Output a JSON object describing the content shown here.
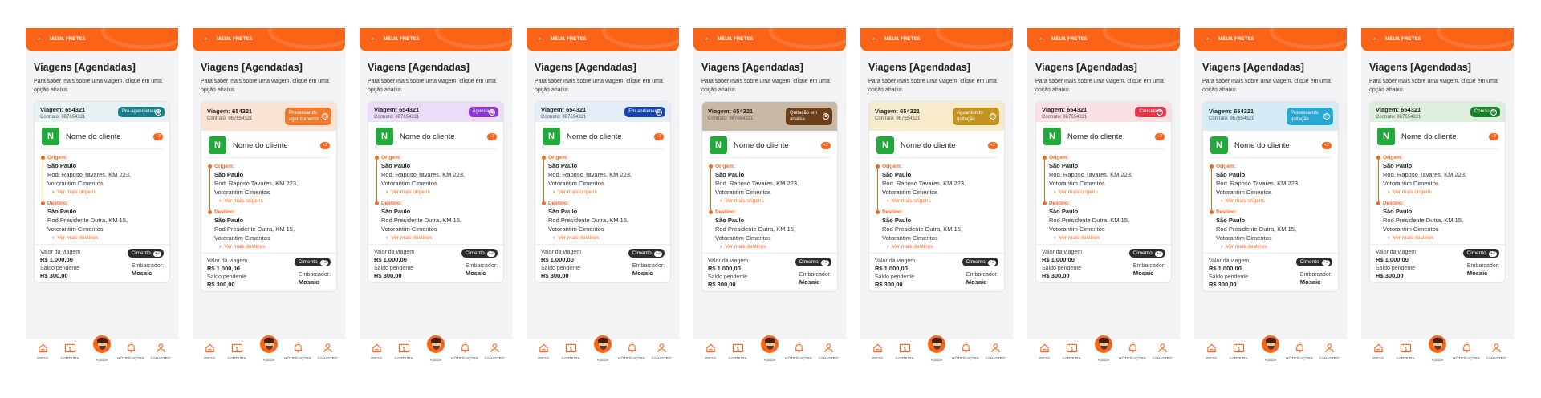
{
  "header_title": "MEUS FRETES",
  "page_title": "Viagens [Agendadas]",
  "page_subtitle": "Para saber mais sobre uma viagem, clique em uma opção abaixo.",
  "trip_label": "Viagem:",
  "trip_number": "654321",
  "contract_text": "Contrato: 987654321",
  "client_initial": "N",
  "client_name": "Nome do cliente",
  "client_more": "+2",
  "origin_label": "Origem:",
  "origin_city": "São Paulo",
  "origin_address_1": "Rod. Raposo Tavares, KM 223,",
  "origin_address_2": "Votorantim Cimentos",
  "more_origins": "Ver mais origens",
  "destination_label": "Destino:",
  "destination_city": "São Paulo",
  "destination_address_1": "Rod Presidente Dutra, KM 15,",
  "destination_address_2": "Votorantim Cimentos",
  "more_destinations": "Ver mais destinos",
  "value_label": "Valor da viagem",
  "value_amount": "R$ 1.000,00",
  "pending_label": "Saldo pendente",
  "pending_amount": "R$ 300,00",
  "cargo_label": "Cimento",
  "cargo_more": "+2",
  "shipper_label": "Embarcador:",
  "shipper_value": "Mosaic",
  "tabs": [
    {
      "label": "INICIO",
      "icon": "home-icon"
    },
    {
      "label": "CARTEIRA",
      "icon": "wallet-icon"
    },
    {
      "label": "AJUDA",
      "icon": "help-avatar"
    },
    {
      "label": "NOTIFICAÇÕES",
      "icon": "bell-icon"
    },
    {
      "label": "CADASTRO",
      "icon": "user-icon"
    }
  ],
  "colors": {
    "brand": "#fb6418",
    "client_logo": "#23a83c",
    "dark_chip": "#2c2c2e"
  },
  "screens": [
    {
      "status": "Pré-agendamento",
      "status_icon": "calendar-icon",
      "head_bg": "#e6f2f4",
      "badge_bg": "#167e87",
      "two_line": false
    },
    {
      "status": "Processando agendamento",
      "status_icon": "clock-icon",
      "head_bg": "#fbe3d4",
      "badge_bg": "#f07a2d",
      "two_line": true
    },
    {
      "status": "Agendado",
      "status_icon": "calendar-icon",
      "head_bg": "#ebdcf7",
      "badge_bg": "#8e37d6",
      "two_line": false
    },
    {
      "status": "Em andamento",
      "status_icon": "truck-icon",
      "head_bg": "#e5edf9",
      "badge_bg": "#1844b0",
      "two_line": false
    },
    {
      "status": "Quitação em analise",
      "status_icon": "hourglass-icon",
      "head_bg": "#c9b8a4",
      "badge_bg": "#6b4018",
      "two_line": true
    },
    {
      "status": "Aguardando quitação",
      "status_icon": "clock-icon",
      "head_bg": "#f7ebcc",
      "badge_bg": "#c59320",
      "two_line": true
    },
    {
      "status": "Cancelado",
      "status_icon": "close-icon",
      "head_bg": "#fbe0e3",
      "badge_bg": "#e3384a",
      "two_line": false
    },
    {
      "status": "Processando quitação",
      "status_icon": "clock-icon",
      "head_bg": "#d3ecf6",
      "badge_bg": "#2aa6d4",
      "two_line": true
    },
    {
      "status": "Concluído",
      "status_icon": "check-icon",
      "head_bg": "#dcefdc",
      "badge_bg": "#1b7e2a",
      "two_line": false
    }
  ]
}
